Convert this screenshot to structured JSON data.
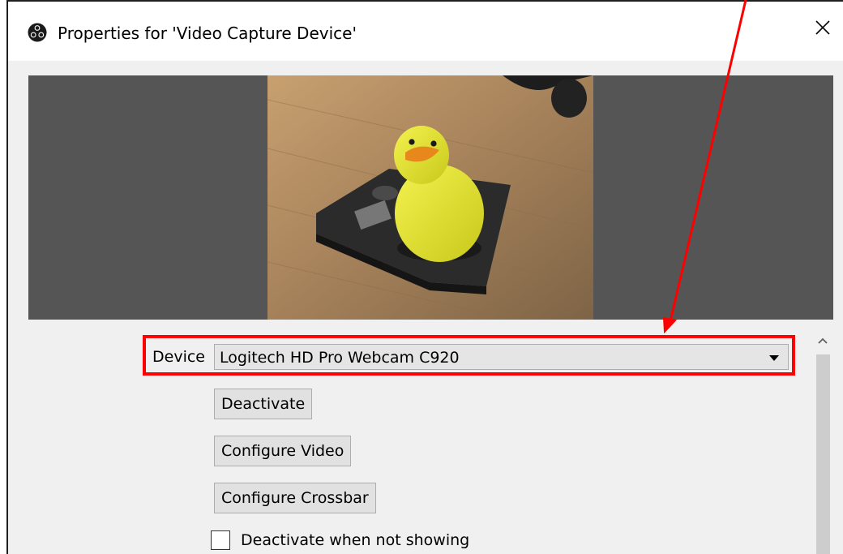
{
  "window": {
    "title": "Properties for 'Video Capture Device'",
    "close_icon": "close-icon"
  },
  "preview": {
    "background": "#555555",
    "image": "webcam preview"
  },
  "device": {
    "label": "Device",
    "value": "Logitech HD Pro Webcam C920",
    "dropdown_icon": "chevron-down-icon"
  },
  "buttons": {
    "deactivate": "Deactivate",
    "configure_video": "Configure Video",
    "configure_crossbar": "Configure Crossbar"
  },
  "options": {
    "deactivate_when_not_showing": "Deactivate when not showing",
    "deactivate_when_not_showing_checked": false
  },
  "annotation": {
    "highlight_color": "#ff0000"
  }
}
